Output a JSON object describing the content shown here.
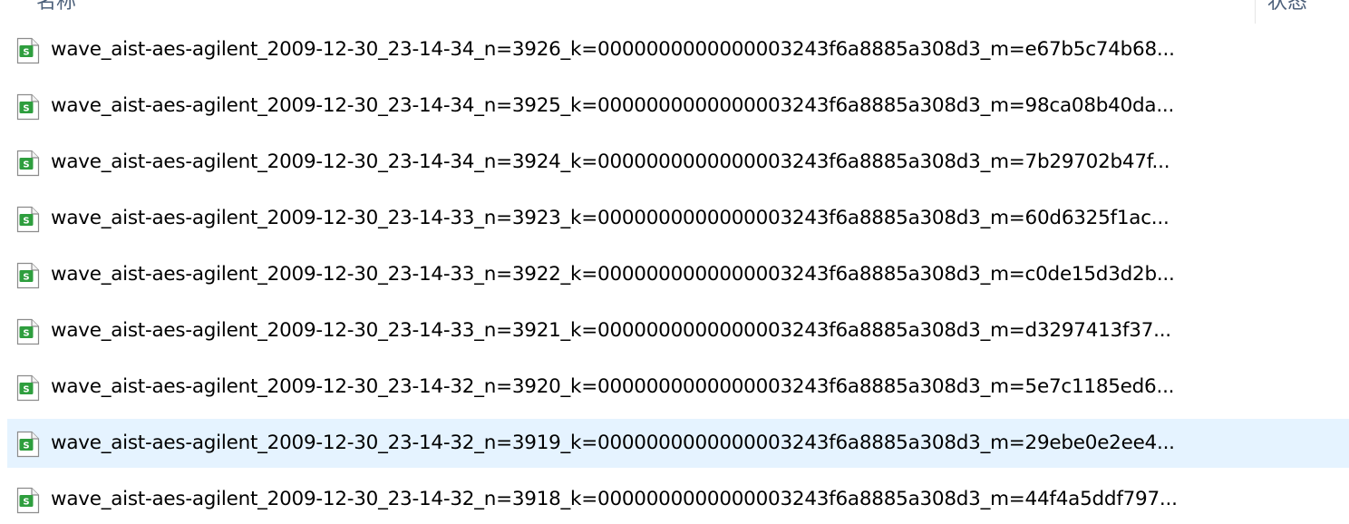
{
  "header": {
    "name_column": "名称",
    "status_column": "状态"
  },
  "files": [
    {
      "name": "wave_aist-aes-agilent_2009-12-30_23-14-34_n=3926_k=0000000000000003243f6a8885a308d3_m=e67b5c74b68...",
      "selected": false,
      "icon": "spreadsheet-file-icon"
    },
    {
      "name": "wave_aist-aes-agilent_2009-12-30_23-14-34_n=3925_k=0000000000000003243f6a8885a308d3_m=98ca08b40da...",
      "selected": false,
      "icon": "spreadsheet-file-icon"
    },
    {
      "name": "wave_aist-aes-agilent_2009-12-30_23-14-34_n=3924_k=0000000000000003243f6a8885a308d3_m=7b29702b47f...",
      "selected": false,
      "icon": "spreadsheet-file-icon"
    },
    {
      "name": "wave_aist-aes-agilent_2009-12-30_23-14-33_n=3923_k=0000000000000003243f6a8885a308d3_m=60d6325f1ac...",
      "selected": false,
      "icon": "spreadsheet-file-icon"
    },
    {
      "name": "wave_aist-aes-agilent_2009-12-30_23-14-33_n=3922_k=0000000000000003243f6a8885a308d3_m=c0de15d3d2b...",
      "selected": false,
      "icon": "spreadsheet-file-icon"
    },
    {
      "name": "wave_aist-aes-agilent_2009-12-30_23-14-33_n=3921_k=0000000000000003243f6a8885a308d3_m=d3297413f37...",
      "selected": false,
      "icon": "spreadsheet-file-icon"
    },
    {
      "name": "wave_aist-aes-agilent_2009-12-30_23-14-32_n=3920_k=0000000000000003243f6a8885a308d3_m=5e7c1185ed6...",
      "selected": false,
      "icon": "spreadsheet-file-icon"
    },
    {
      "name": "wave_aist-aes-agilent_2009-12-30_23-14-32_n=3919_k=0000000000000003243f6a8885a308d3_m=29ebe0e2ee4...",
      "selected": true,
      "icon": "spreadsheet-file-icon"
    },
    {
      "name": "wave_aist-aes-agilent_2009-12-30_23-14-32_n=3918_k=0000000000000003243f6a8885a308d3_m=44f4a5ddf797...",
      "selected": false,
      "icon": "spreadsheet-file-icon"
    }
  ],
  "colors": {
    "selection_bg": "#e5f3ff",
    "icon_green": "#2e9e3e",
    "header_text": "#4c607a"
  }
}
